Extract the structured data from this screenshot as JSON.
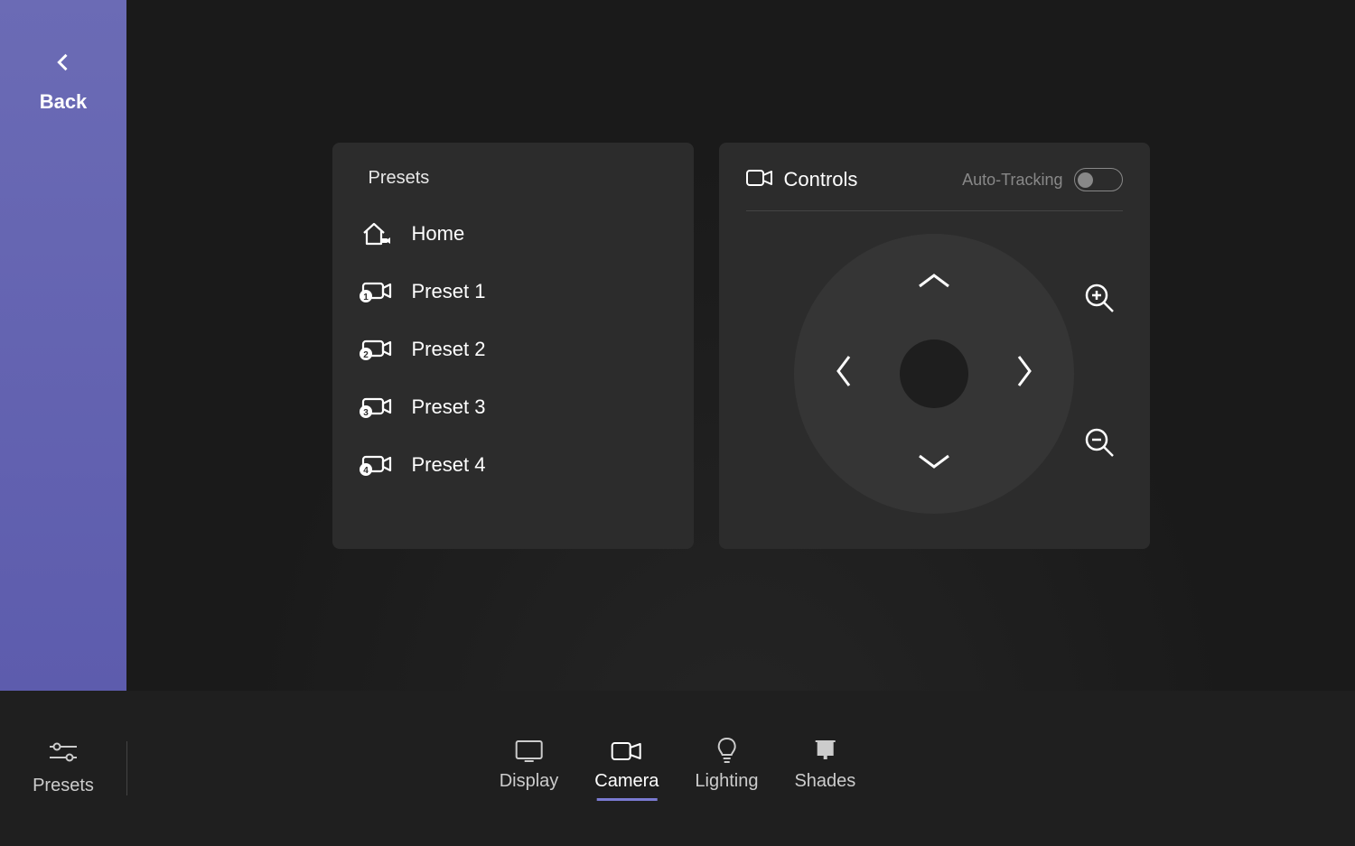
{
  "sidebar": {
    "back_label": "Back"
  },
  "presets": {
    "title": "Presets",
    "items": [
      {
        "label": "Home"
      },
      {
        "label": "Preset 1"
      },
      {
        "label": "Preset 2"
      },
      {
        "label": "Preset 3"
      },
      {
        "label": "Preset 4"
      }
    ]
  },
  "controls": {
    "title": "Controls",
    "auto_tracking_label": "Auto-Tracking",
    "auto_tracking_on": false
  },
  "bottom": {
    "presets_label": "Presets",
    "tabs": [
      {
        "label": "Display"
      },
      {
        "label": "Camera"
      },
      {
        "label": "Lighting"
      },
      {
        "label": "Shades"
      }
    ],
    "active_tab": "Camera"
  }
}
